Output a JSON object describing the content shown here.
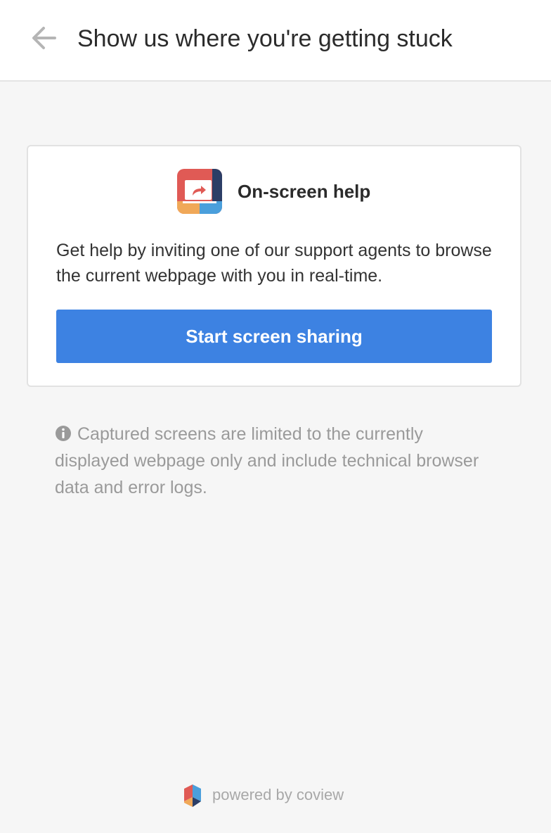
{
  "header": {
    "back_icon": "arrow-left-icon",
    "title": "Show us where you're getting stuck"
  },
  "card": {
    "icon": "screen-share-app-icon",
    "title": "On-screen help",
    "description": "Get help by inviting one of our support agents to browse the current webpage with you in real-time.",
    "button_label": "Start screen sharing"
  },
  "note": {
    "icon": "info-circle-icon",
    "text": "Captured screens are limited to the currently displayed webpage only and include technical browser data and error logs."
  },
  "footer": {
    "logo": "coview-logo",
    "text": "powered by coview"
  },
  "colors": {
    "accent": "#3d82e2",
    "background": "#f6f6f6",
    "icon_red": "#e05a55",
    "icon_orange": "#f0a858",
    "icon_blue": "#4a9fdc",
    "icon_navy": "#2c3e66"
  }
}
